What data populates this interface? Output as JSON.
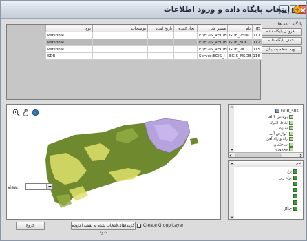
{
  "window": {
    "title": "انتخاب پایگاه داده و ورود اطلاعات"
  },
  "side_panel": {
    "label": "پایگاه داده ها:",
    "buttons": [
      "افزودن پایگاه داده",
      "حذف پایگاه داده",
      "تهیه نسخه پشتیبان"
    ]
  },
  "db_table": {
    "columns": [
      "ID",
      "نام",
      "مسیر فایل",
      "ایجاد کننده",
      "تاریخ ایجاد",
      "توضیحات",
      "نوع"
    ],
    "rows": [
      {
        "id": "117",
        "name": "GDB_250K",
        "path": "E:\\EGIS_REC\\Bi",
        "creator": "",
        "date": "",
        "desc": "",
        "type": "Personal",
        "selected": false
      },
      {
        "id": "112",
        "name": "GDB_50K",
        "path": "E:\\EGIS_REC\\Bi",
        "creator": "",
        "date": "",
        "desc": "",
        "type": "Personal",
        "selected": true
      },
      {
        "id": "115",
        "name": "GDB_2K",
        "path": "E:\\EGIS_REC\\Bi",
        "creator": "",
        "date": "",
        "desc": "",
        "type": "Personal",
        "selected": false
      },
      {
        "id": "116",
        "name": "EGIS_NSDB",
        "path": "Server:EGIS_I",
        "creator": "",
        "date": "",
        "desc": "",
        "type": "SDE",
        "selected": false
      }
    ]
  },
  "map": {
    "view_label": "View:",
    "view_value": ""
  },
  "tree": {
    "root": "GDB_50K",
    "items": [
      "پوشش گیاهی",
      "نقاط کنترل",
      "سازه",
      "عوارض آبی",
      "راه و راه آهن",
      "ساختمان",
      "محدوده"
    ]
  },
  "selection": {
    "header": "نام",
    "rows": [
      {
        "label": "باغ",
        "active": true
      },
      {
        "label": "بوته زار",
        "active": true
      },
      {
        "label": "",
        "active": false
      },
      {
        "label": "",
        "active": false
      },
      {
        "label": "",
        "active": false
      },
      {
        "label": "",
        "active": false
      },
      {
        "label": "جنگل",
        "active": true
      }
    ]
  },
  "footer": {
    "exit_label": "خروج",
    "create_group_layer_label": "Create Group Layer",
    "add_selected_label": "گزینه(های)انتخاب شده به نقشه افزوده شود"
  },
  "colors": {
    "map_green": "#6f8a2e",
    "map_yellow": "#dfe06a",
    "map_purple": "#b6a3de"
  }
}
